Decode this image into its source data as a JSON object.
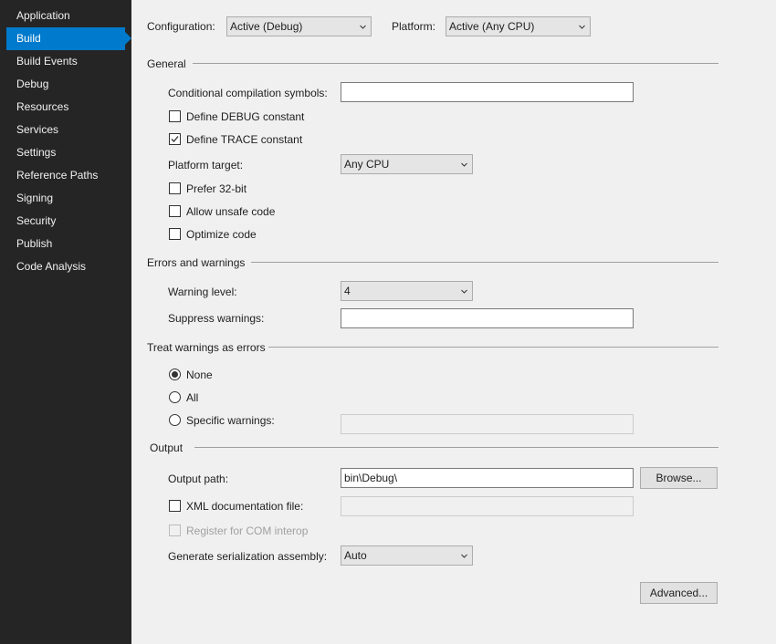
{
  "sidebar": {
    "items": [
      {
        "label": "Application"
      },
      {
        "label": "Build"
      },
      {
        "label": "Build Events"
      },
      {
        "label": "Debug"
      },
      {
        "label": "Resources"
      },
      {
        "label": "Services"
      },
      {
        "label": "Settings"
      },
      {
        "label": "Reference Paths"
      },
      {
        "label": "Signing"
      },
      {
        "label": "Security"
      },
      {
        "label": "Publish"
      },
      {
        "label": "Code Analysis"
      }
    ],
    "active": "Build",
    "colors": {
      "background": "#252526",
      "active": "#007acc",
      "text": "#f1f1f1"
    }
  },
  "toolbar": {
    "configuration_label": "Configuration:",
    "configuration_value": "Active (Debug)",
    "platform_label": "Platform:",
    "platform_value": "Active (Any CPU)"
  },
  "general": {
    "title": "General",
    "conditional_symbols_label": "Conditional compilation symbols:",
    "conditional_symbols_value": "",
    "define_debug_label": "Define DEBUG constant",
    "define_debug_checked": false,
    "define_trace_label": "Define TRACE constant",
    "define_trace_checked": true,
    "platform_target_label": "Platform target:",
    "platform_target_value": "Any CPU",
    "prefer32_label": "Prefer 32-bit",
    "prefer32_checked": false,
    "unsafe_label": "Allow unsafe code",
    "unsafe_checked": false,
    "optimize_label": "Optimize code",
    "optimize_checked": false
  },
  "errors": {
    "title": "Errors and warnings",
    "warning_level_label": "Warning level:",
    "warning_level_value": "4",
    "suppress_label": "Suppress warnings:",
    "suppress_value": ""
  },
  "treat": {
    "title": "Treat warnings as errors",
    "none_label": "None",
    "all_label": "All",
    "specific_label": "Specific warnings:",
    "selected": "None",
    "specific_value": ""
  },
  "output": {
    "title": "Output",
    "output_path_label": "Output path:",
    "output_path_value": "bin\\Debug\\",
    "browse_label": "Browse...",
    "xml_doc_label": "XML documentation file:",
    "xml_doc_checked": false,
    "xml_doc_value": "",
    "com_interop_label": "Register for COM interop",
    "com_interop_checked": false,
    "serialization_label": "Generate serialization assembly:",
    "serialization_value": "Auto",
    "advanced_label": "Advanced..."
  }
}
